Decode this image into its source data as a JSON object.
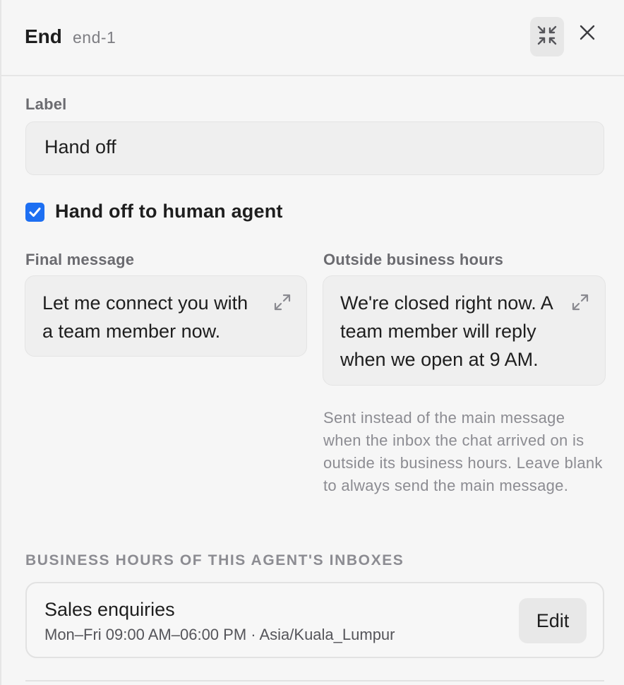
{
  "header": {
    "title": "End",
    "node_id": "end-1",
    "collapse_icon": "collapse-icon",
    "close_icon": "close-icon"
  },
  "label_field": {
    "label": "Label",
    "value": "Hand off"
  },
  "handoff": {
    "checked": true,
    "label": "Hand off to human agent"
  },
  "final_message": {
    "label": "Final message",
    "value": "Let me connect you with a team member now.",
    "expand_icon": "expand-icon"
  },
  "outside_hours": {
    "label": "Outside business hours",
    "value": "We're closed right now. A team member will reply when we open at 9 AM.",
    "expand_icon": "expand-icon",
    "help": "Sent instead of the main message when the inbox the chat arrived on is outside its business hours. Leave blank to always send the main message."
  },
  "business_hours": {
    "section_title": "BUSINESS HOURS OF THIS AGENT'S INBOXES",
    "inboxes": [
      {
        "name": "Sales enquiries",
        "hours": "Mon–Fri 09:00 AM–06:00 PM · Asia/Kuala_Lumpur",
        "edit_label": "Edit"
      }
    ]
  },
  "colors": {
    "accent": "#1d6ff2",
    "background": "#f6f6f6",
    "field_background": "#efefef"
  }
}
